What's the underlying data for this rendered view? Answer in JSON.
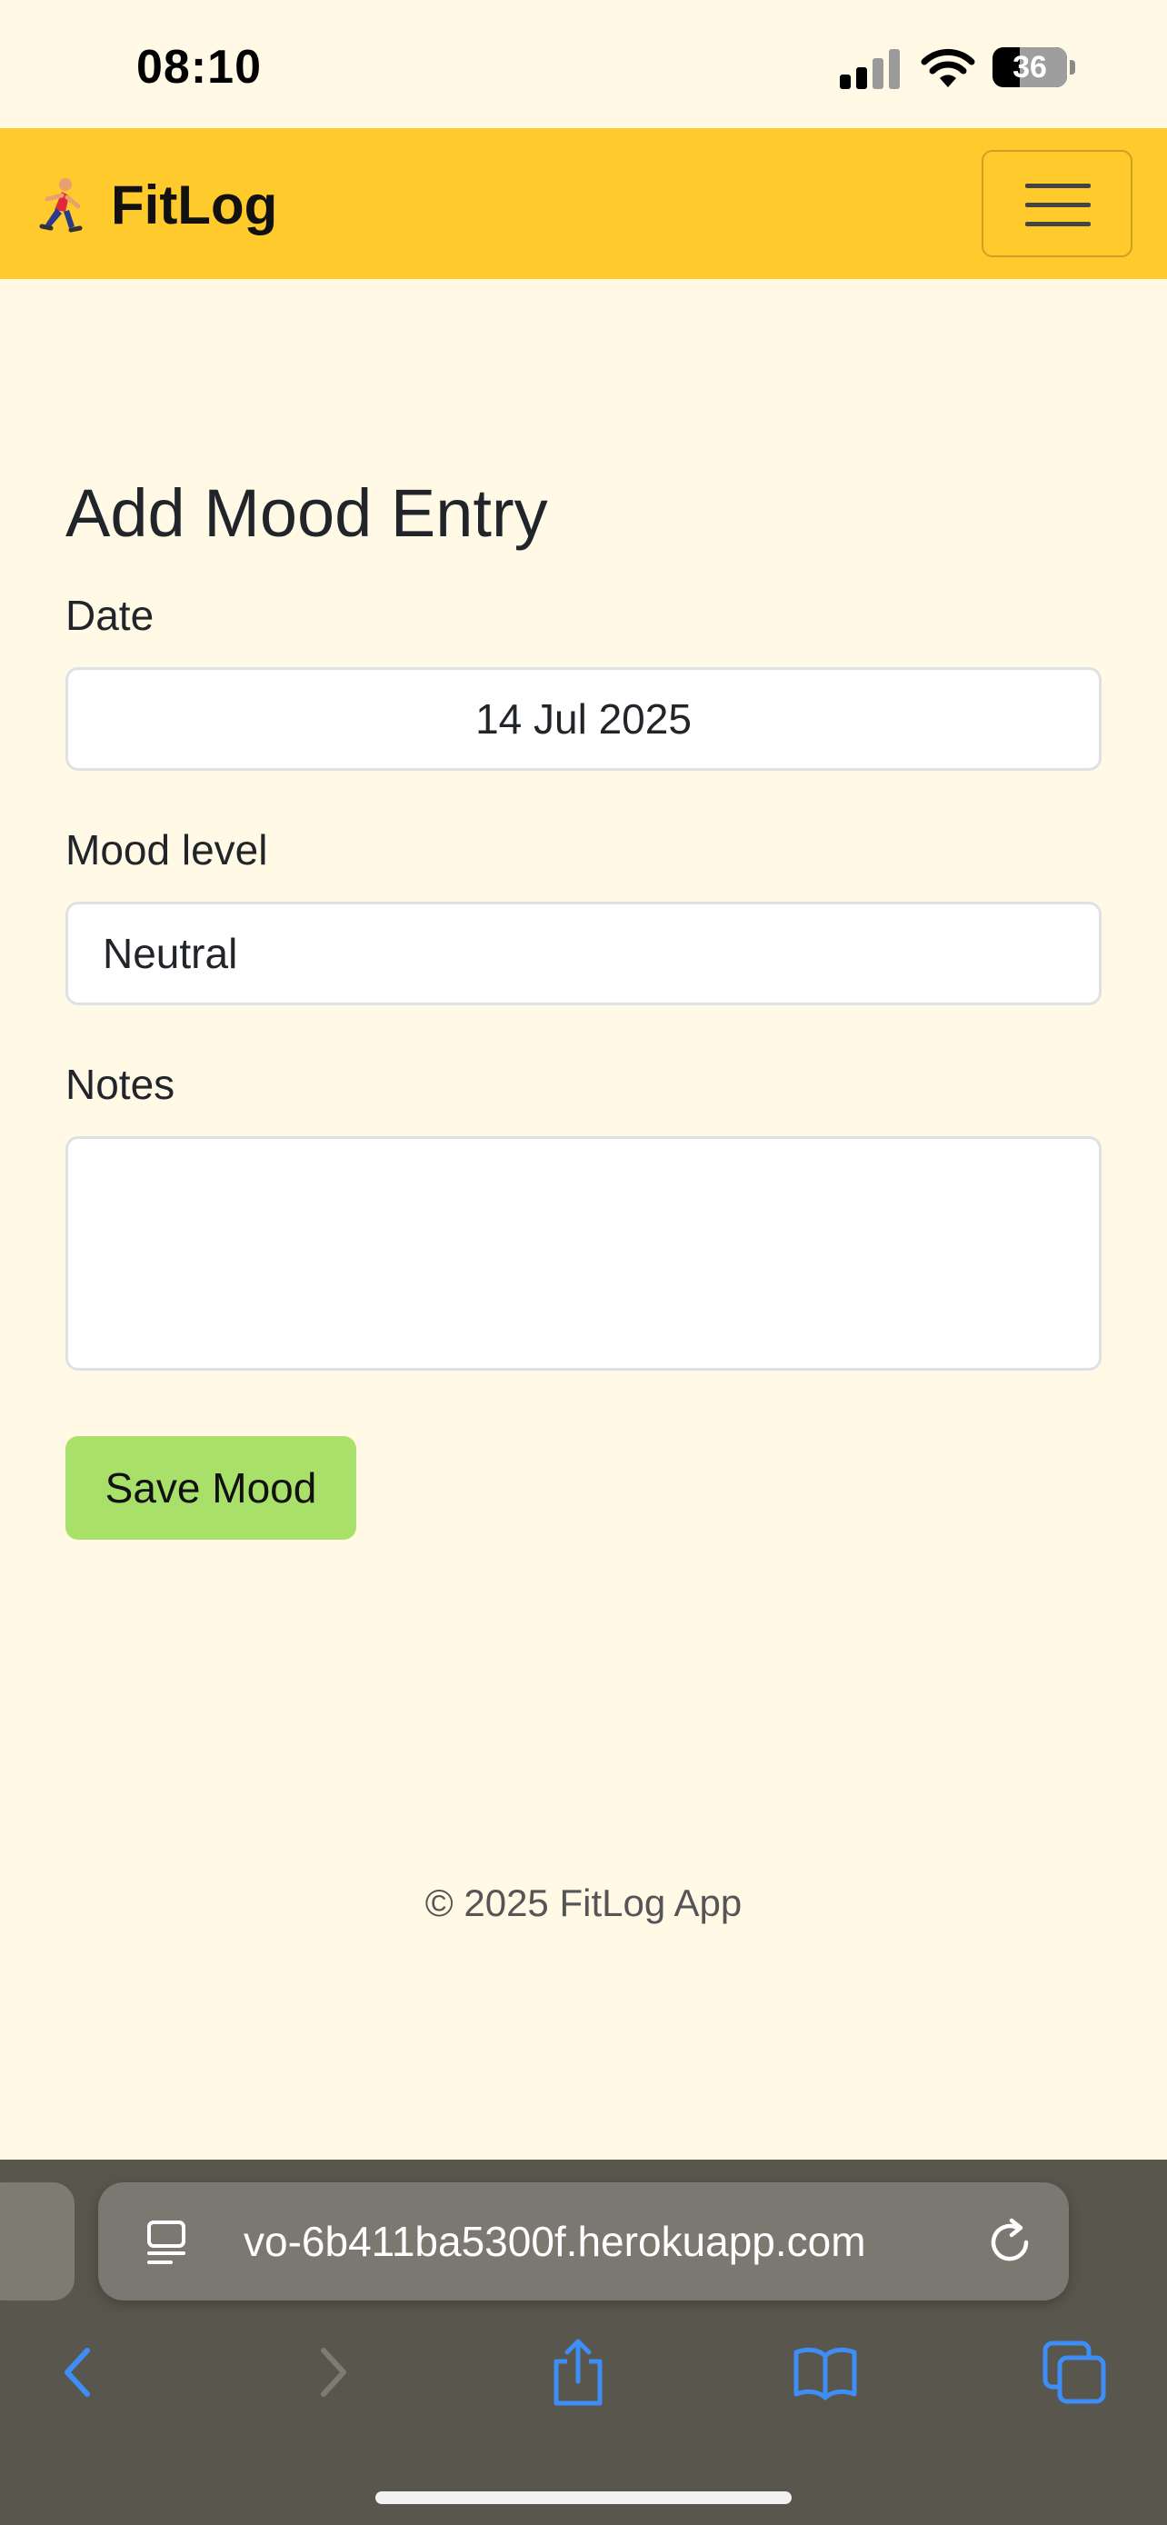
{
  "status_bar": {
    "time": "08:10",
    "battery_percent": "36",
    "battery_level": 0.36
  },
  "navbar": {
    "brand": "FitLog",
    "brand_icon": "runner-icon",
    "menu_icon": "hamburger-icon"
  },
  "form": {
    "title": "Add Mood Entry",
    "date_label": "Date",
    "date_value": "14 Jul 2025",
    "mood_label": "Mood level",
    "mood_value": "Neutral",
    "notes_label": "Notes",
    "notes_value": "",
    "save_label": "Save Mood"
  },
  "footer": {
    "text": "© 2025 FitLog App"
  },
  "browser": {
    "url": "vo-6b411ba5300f.herokuapp.com",
    "toolbar_icons": [
      "back-icon",
      "forward-icon",
      "share-icon",
      "bookmarks-icon",
      "tabs-icon"
    ]
  },
  "colors": {
    "page_bg": "#fff9e6",
    "navbar_bg": "#ffca2c",
    "save_button_bg": "#a8e06a",
    "safari_bar_bg": "#59574d",
    "link_blue": "#3e8ef7"
  }
}
